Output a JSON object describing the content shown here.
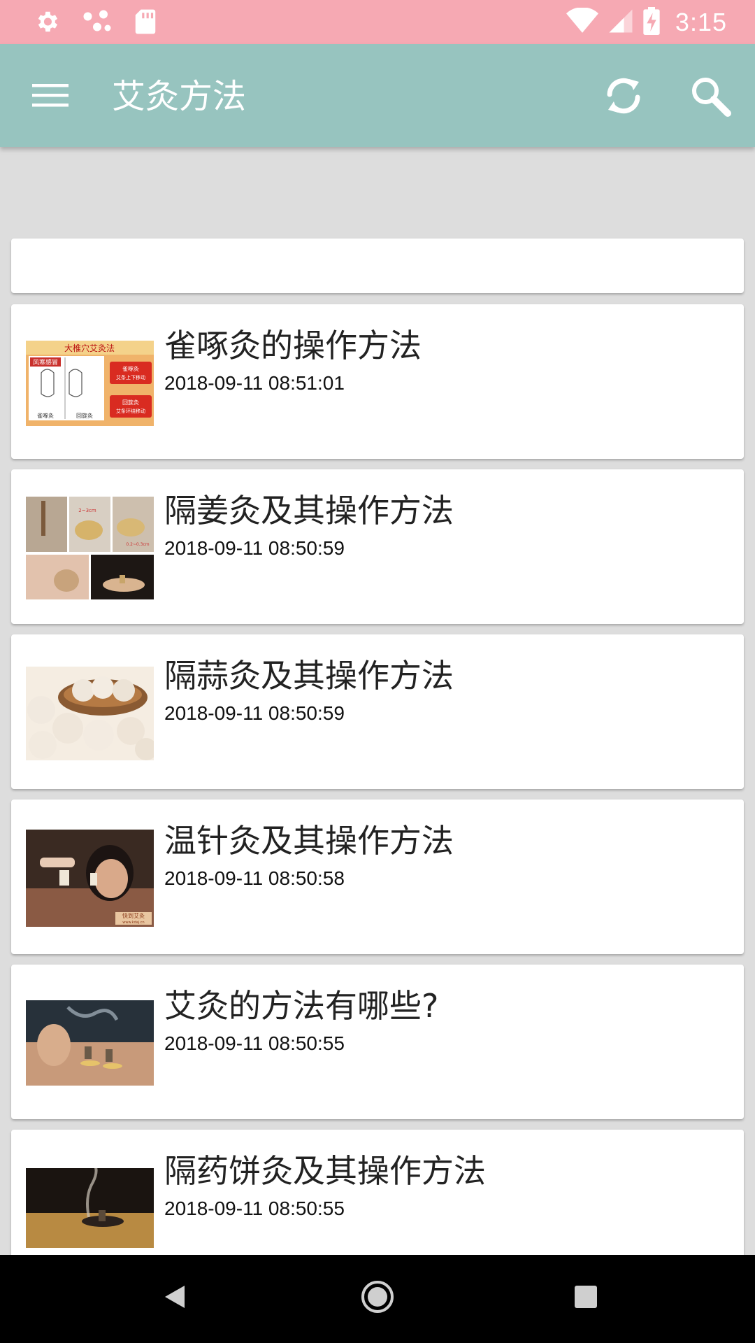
{
  "status_bar": {
    "time": "3:15",
    "icons": [
      "settings-icon",
      "share-dots-icon",
      "sd-card-icon",
      "wifi-icon",
      "signal-icon",
      "battery-charging-icon"
    ]
  },
  "app_bar": {
    "title": "艾灸方法",
    "icons": [
      "menu-icon",
      "refresh-icon",
      "search-icon"
    ]
  },
  "articles": [
    {
      "title": "雀啄灸的操作方法",
      "date": "2018-09-11 08:51:01",
      "thumbnail_text": {
        "top": "大椎穴艾灸法",
        "tag": "风寒感冒",
        "box1": "雀啄灸",
        "box1_sub": "艾条上下移动",
        "box2": "回旋灸",
        "box2_sub": "艾条环绕移动",
        "left_caption": "雀啄灸",
        "right_caption": "回旋灸"
      }
    },
    {
      "title": "隔姜灸及其操作方法",
      "date": "2018-09-11 08:50:59",
      "thumbnail_text": {
        "dim1": "2~3cm",
        "dim2": "0.2~0.3cm"
      }
    },
    {
      "title": "隔蒜灸及其操作方法",
      "date": "2018-09-11 08:50:59"
    },
    {
      "title": "温针灸及其操作方法",
      "date": "2018-09-11 08:50:58",
      "thumbnail_text": {
        "logo": "快到艾灸",
        "url": "www.kdaj.cn"
      }
    },
    {
      "title": "艾灸的方法有哪些?",
      "date": "2018-09-11 08:50:55"
    },
    {
      "title": "隔药饼灸及其操作方法",
      "date": "2018-09-11 08:50:55"
    }
  ],
  "nav_bar": {
    "icons": [
      "back-icon",
      "home-icon",
      "recents-icon"
    ]
  },
  "colors": {
    "status_bar": "#f6a9b3",
    "app_bar": "#97c4bf",
    "background": "#dddddd",
    "card": "#ffffff"
  }
}
